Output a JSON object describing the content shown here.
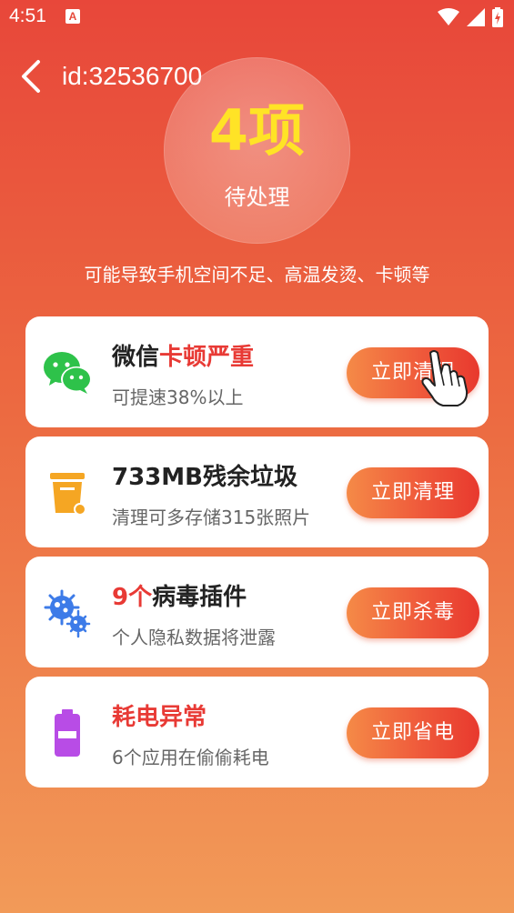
{
  "status_bar": {
    "time": "4:51",
    "notif_icon": "A"
  },
  "header": {
    "id_label": "id:32536700"
  },
  "summary": {
    "count": "4项",
    "label": "待处理",
    "warning": "可能导致手机空间不足、高温发烫、卡顿等"
  },
  "colors": {
    "accent_red": "#e83a35",
    "count_yellow": "#ffe326",
    "wechat_green": "#2ec24a",
    "trash_orange": "#f5a623",
    "virus_blue": "#3d7be8",
    "battery_purple": "#b84ce6"
  },
  "cards": [
    {
      "icon": "wechat-icon",
      "title_prefix": "微信",
      "title_highlight": "卡顿严重",
      "title_suffix": "",
      "subtitle": "可提速38%以上",
      "button": "立即清理"
    },
    {
      "icon": "trash-icon",
      "title_prefix": "733MB残余垃圾",
      "title_highlight": "",
      "title_suffix": "",
      "subtitle": "清理可多存储315张照片",
      "button": "立即清理"
    },
    {
      "icon": "virus-icon",
      "title_prefix": "",
      "title_highlight": "9个",
      "title_suffix": "病毒插件",
      "subtitle": "个人隐私数据将泄露",
      "button": "立即杀毒"
    },
    {
      "icon": "battery-icon",
      "title_prefix": "",
      "title_highlight": "耗电异常",
      "title_suffix": "",
      "subtitle": "6个应用在偷偷耗电",
      "button": "立即省电"
    }
  ]
}
